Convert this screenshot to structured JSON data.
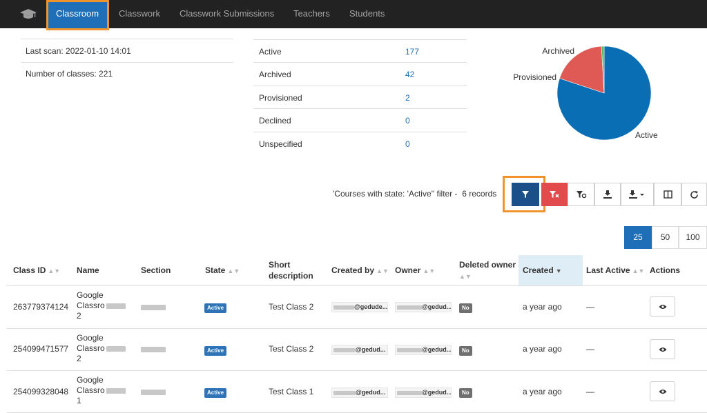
{
  "nav": {
    "brand_icon": "graduation-cap-icon",
    "tabs": [
      {
        "label": "Classroom",
        "active": true
      },
      {
        "label": "Classwork",
        "active": false
      },
      {
        "label": "Classwork Submissions",
        "active": false
      },
      {
        "label": "Teachers",
        "active": false
      },
      {
        "label": "Students",
        "active": false
      }
    ]
  },
  "summary": {
    "last_scan": "Last scan: 2022-01-10 14:01",
    "num_classes": "Number of classes: 221"
  },
  "stats": [
    {
      "label": "Active",
      "value": "177"
    },
    {
      "label": "Archived",
      "value": "42"
    },
    {
      "label": "Provisioned",
      "value": "2"
    },
    {
      "label": "Declined",
      "value": "0"
    },
    {
      "label": "Unspecified",
      "value": "0"
    }
  ],
  "chart_data": {
    "type": "pie",
    "labels": [
      "Active",
      "Archived",
      "Provisioned",
      "Declined",
      "Unspecified"
    ],
    "values": [
      177,
      42,
      2,
      0,
      0
    ],
    "colors": [
      "#0a6eb4",
      "#e05a55",
      "#5cb85c",
      "#f0ad4e",
      "#999999"
    ],
    "slice_labels": [
      "Active",
      "Archived",
      "Provisioned"
    ]
  },
  "toolbar": {
    "filter_text": "'Courses with state: 'Active'' filter -",
    "records_text": "6 records",
    "buttons": [
      "filter-icon",
      "clear-filter-icon",
      "filter-settings-icon",
      "download-icon",
      "export-dropdown-icon",
      "columns-icon",
      "refresh-icon"
    ]
  },
  "pagination": [
    "25",
    "50",
    "100"
  ],
  "table": {
    "headers": {
      "class_id": "Class ID",
      "name": "Name",
      "section": "Section",
      "state": "State",
      "short_desc_1": "Short",
      "short_desc_2": "description",
      "created_by": "Created by",
      "owner": "Owner",
      "deleted_owner": "Deleted owner",
      "created": "Created",
      "last_active": "Last Active",
      "actions": "Actions"
    },
    "rows": [
      {
        "class_id": "263779374124",
        "name_1": "Google",
        "name_2": "Classro",
        "name_3": "2",
        "state": "Active",
        "desc": "Test Class 2",
        "created_by": "@gedude...",
        "owner": "@gedud...",
        "deleted": "No",
        "created": "a year ago",
        "last_active": "—"
      },
      {
        "class_id": "254099471577",
        "name_1": "Google",
        "name_2": "Classro",
        "name_3": "2",
        "state": "Active",
        "desc": "Test Class 2",
        "created_by": "@gedud...",
        "owner": "@gedud...",
        "deleted": "No",
        "created": "a year ago",
        "last_active": "—"
      },
      {
        "class_id": "254099328048",
        "name_1": "Google",
        "name_2": "Classro",
        "name_3": "1",
        "state": "Active",
        "desc": "Test Class 1",
        "created_by": "@gedud...",
        "owner": "@gedud...",
        "deleted": "No",
        "created": "a year ago",
        "last_active": "—"
      }
    ]
  }
}
